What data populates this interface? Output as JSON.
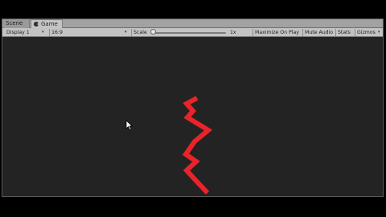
{
  "tabs": {
    "scene_label": "Scene",
    "game_label": "Game"
  },
  "toolbar": {
    "display_label": "Display 1",
    "aspect_label": "16:9",
    "scale_label": "Scale",
    "scale_value": "1x",
    "scale_fraction": 0.0,
    "maximize_label": "Maximize On Play",
    "mute_label": "Mute Audio",
    "stats_label": "Stats",
    "gizmos_label": "Gizmos"
  },
  "icons": {
    "game_tab_icon": "pacman-icon",
    "cursor": "mouse-pointer-icon"
  },
  "colors": {
    "viewport_background": "#232323",
    "bolt_color": "#e8242a"
  }
}
